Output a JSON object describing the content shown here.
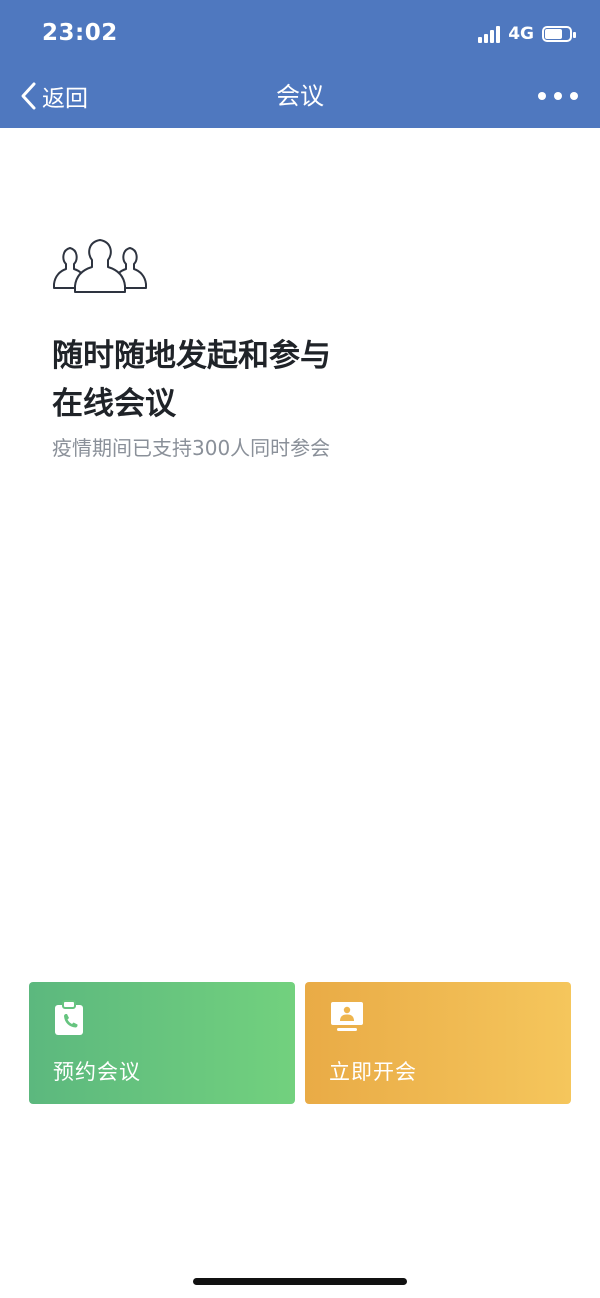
{
  "status_bar": {
    "time": "23:02",
    "network": "4G",
    "battery_level": 0.7
  },
  "nav": {
    "back_label": "返回",
    "title": "会议"
  },
  "hero": {
    "icon": "people-group-icon",
    "headline_line1": "随时随地发起和参与",
    "headline_line2": "在线会议",
    "subtitle": "疫情期间已支持300人同时参会"
  },
  "actions": {
    "schedule": {
      "label": "预约会议",
      "icon": "calendar-phone-icon",
      "color_start": "#5cb87e",
      "color_end": "#72d17e"
    },
    "start": {
      "label": "立即开会",
      "icon": "presentation-screen-icon",
      "color_start": "#e9ab46",
      "color_end": "#f5c65c"
    }
  },
  "colors": {
    "header": "#4f78bf",
    "headline": "#1f2328",
    "subtitle": "#8a9099"
  }
}
